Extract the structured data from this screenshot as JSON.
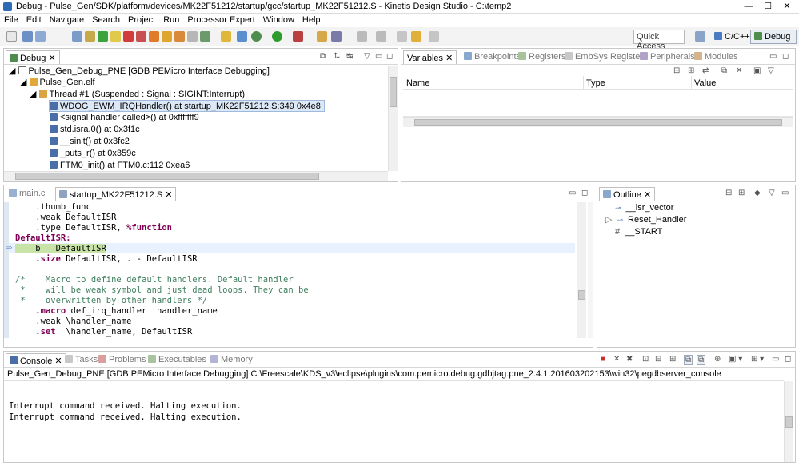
{
  "window": {
    "title": "Debug - Pulse_Gen/SDK/platform/devices/MK22F51212/startup/gcc/startup_MK22F51212.S - Kinetis Design Studio - C:\\temp2",
    "minimize": "—",
    "maximize": "☐",
    "close": "✕"
  },
  "menu": [
    "File",
    "Edit",
    "Navigate",
    "Search",
    "Project",
    "Run",
    "Processor Expert",
    "Window",
    "Help"
  ],
  "toolbar": {
    "quick_access": "Quick Access",
    "perspective_cpp": "C/C++",
    "perspective_debug": "Debug"
  },
  "debug_view": {
    "tab": "Debug",
    "launch": "Pulse_Gen_Debug_PNE [GDB PEMicro Interface Debugging]",
    "elf": "Pulse_Gen.elf",
    "thread": "Thread #1 (Suspended : Signal : SIGINT:Interrupt)",
    "frames": [
      "WDOG_EWM_IRQHandler() at startup_MK22F51212.S:349 0x4e8",
      "<signal handler called>() at 0xfffffff9",
      "std.isra.0() at 0x3f1c",
      "__sinit() at 0x3fc2",
      "_puts_r() at 0x359c",
      "FTM0_init() at FTM0.c:112 0xea6"
    ]
  },
  "variables_view": {
    "tabs": [
      "Variables",
      "Breakpoints",
      "Registers",
      "EmbSys Registers",
      "Peripherals",
      "Modules"
    ],
    "columns": [
      "Name",
      "Type",
      "Value"
    ]
  },
  "editor": {
    "tabs": [
      "main.c",
      "startup_MK22F51212.S"
    ],
    "lines": [
      {
        "pre": "    .thumb_func",
        "kw": "",
        "post": ""
      },
      {
        "pre": "    .weak DefaultISR",
        "kw": "",
        "post": ""
      },
      {
        "pre": "    .type DefaultISR, ",
        "kw": "%function",
        "post": ""
      },
      {
        "pre": "",
        "kw": "DefaultISR:",
        "post": ""
      },
      {
        "pre": "    b   DefaultISR",
        "kw": "",
        "post": ""
      },
      {
        "pre": "    ",
        "kw": ".size",
        "post": " DefaultISR, . - DefaultISR"
      },
      {
        "pre": "",
        "kw": "",
        "post": ""
      },
      {
        "pre": "",
        "kw": "",
        "post": "",
        "cmt": "/*    Macro to define default handlers. Default handler"
      },
      {
        "pre": "",
        "kw": "",
        "post": "",
        "cmt": " *    will be weak symbol and just dead loops. They can be"
      },
      {
        "pre": "",
        "kw": "",
        "post": "",
        "cmt": " *    overwritten by other handlers */"
      },
      {
        "pre": "    ",
        "kw": ".macro",
        "post": " def_irq_handler  handler_name"
      },
      {
        "pre": "    .weak \\handler_name",
        "kw": "",
        "post": ""
      },
      {
        "pre": "    ",
        "kw": ".set",
        "post": "  \\handler_name, DefaultISR"
      }
    ]
  },
  "outline": {
    "tab": "Outline",
    "items": [
      "__isr_vector",
      "Reset_Handler",
      "__START"
    ]
  },
  "console": {
    "tabs": [
      "Console",
      "Tasks",
      "Problems",
      "Executables",
      "Memory"
    ],
    "launch_line": "Pulse_Gen_Debug_PNE [GDB PEMicro Interface Debugging] C:\\Freescale\\KDS_v3\\eclipse\\plugins\\com.pemicro.debug.gdbjtag.pne_2.4.1.201603202153\\win32\\pegdbserver_console",
    "output": [
      "Interrupt command received. Halting execution.",
      "Interrupt command received. Halting execution."
    ]
  }
}
